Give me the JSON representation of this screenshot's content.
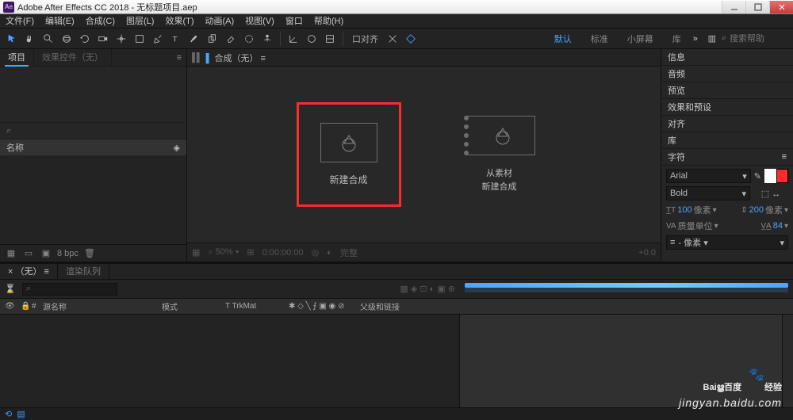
{
  "window": {
    "title": "Adobe After Effects CC 2018 - 无标题项目.aep"
  },
  "menu": [
    "文件(F)",
    "编辑(E)",
    "合成(C)",
    "图层(L)",
    "效果(T)",
    "动画(A)",
    "视图(V)",
    "窗口",
    "帮助(H)"
  ],
  "toolbar": {
    "snap_label": "口对齐",
    "workspaces": [
      "默认",
      "标准",
      "小屏幕",
      "库"
    ],
    "search_placeholder": "搜索帮助"
  },
  "project": {
    "tab_project": "项目",
    "tab_effects": "效果控件（无）",
    "search_icon": "⌕",
    "col_name": "名称",
    "bpc": "8 bpc"
  },
  "comp": {
    "tab": "合成（无）",
    "grip": "▌▌",
    "new_comp": "新建合成",
    "from_footage_l1": "从素材",
    "from_footage_l2": "新建合成",
    "zoom": "50%",
    "timecode": "0:00:00:00",
    "view": "完整"
  },
  "side_panels": [
    "信息",
    "音频",
    "预览",
    "效果和预设",
    "对齐",
    "库"
  ],
  "char": {
    "title": "字符",
    "font": "Arial",
    "weight": "Bold",
    "size_v": "100",
    "size_u": "像素",
    "lead_v": "200",
    "lead_u": "像素",
    "track_v": "质量单位",
    "kern_v": "84",
    "para": "- 像素 ▾"
  },
  "timeline": {
    "tab_none": "（无）",
    "tab_rq": "渲染队列",
    "col_src": "源名称",
    "col_mode": "模式",
    "col_trk": "T   TrkMat",
    "col_parent": "父级和链接"
  },
  "watermark": {
    "brand": "Baiൠ百度",
    "suffix": "经验",
    "sub": "jingyan.baidu.com"
  }
}
